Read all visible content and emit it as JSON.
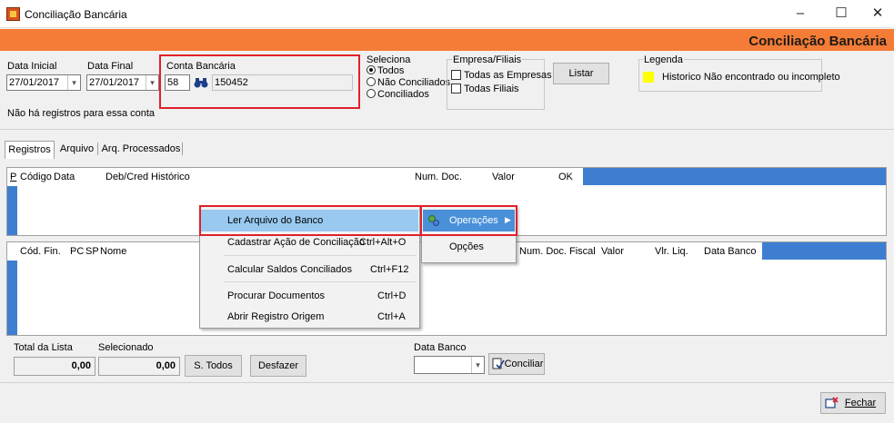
{
  "window": {
    "title": "Conciliação Bancária",
    "minimize": "–",
    "maximize": "☐",
    "close": "✕"
  },
  "banner": {
    "title": "Conciliação Bancária"
  },
  "filters": {
    "data_inicial_label": "Data Inicial",
    "data_inicial_value": "27/01/2017",
    "data_final_label": "Data Final",
    "data_final_value": "27/01/2017",
    "conta_label": "Conta Bancária",
    "conta_code": "58",
    "conta_number": "150452",
    "message": "Não há registros para essa conta"
  },
  "seleciona": {
    "label": "Seleciona",
    "options": [
      "Todos",
      "Não Conciliados",
      "Conciliados"
    ],
    "selected": "Todos"
  },
  "empresa": {
    "label": "Empresa/Filiais",
    "options": [
      "Todas as Empresas",
      "Todas Filiais"
    ]
  },
  "listar_button": "Listar",
  "legenda": {
    "label": "Legenda",
    "item": "Historico Não encontrado ou incompleto",
    "color": "#ffff00"
  },
  "tabs": [
    "Registros",
    "Arquivo",
    "Arq. Processados"
  ],
  "grid1": {
    "columns": [
      "P",
      "Código",
      "Data",
      "Deb/Cred",
      "Histórico",
      "Num. Doc.",
      "Valor",
      "OK"
    ]
  },
  "grid2": {
    "columns": [
      "Cód. Fin.",
      "PC",
      "SP",
      "Nome",
      "Num. Doc. Fiscal",
      "Valor",
      "Vlr. Liq.",
      "Data Banco"
    ]
  },
  "context_menu": {
    "items": [
      {
        "label": "Ler Arquivo do Banco",
        "shortcut": ""
      },
      {
        "label": "Cadastrar Ação de Conciliação",
        "shortcut": "Ctrl+Alt+O"
      },
      {
        "label": "Calcular Saldos Conciliados",
        "shortcut": "Ctrl+F12"
      },
      {
        "label": "Procurar Documentos",
        "shortcut": "Ctrl+D"
      },
      {
        "label": "Abrir Registro Origem",
        "shortcut": "Ctrl+A"
      }
    ]
  },
  "main_menu": {
    "operacoes": "Operações",
    "opcoes": "Opções"
  },
  "footer": {
    "total_label": "Total da Lista",
    "total_value": "0,00",
    "selecionado_label": "Selecionado",
    "selecionado_value": "0,00",
    "s_todos": "S. Todos",
    "desfazer": "Desfazer",
    "data_banco_label": "Data Banco",
    "conciliar": "Conciliar",
    "fechar": "Fechar"
  },
  "colors": {
    "banner": "#f47c36",
    "accent_blue": "#3e7ed1",
    "highlight": "#99c9ef",
    "annotation_red": "#e0202a"
  }
}
